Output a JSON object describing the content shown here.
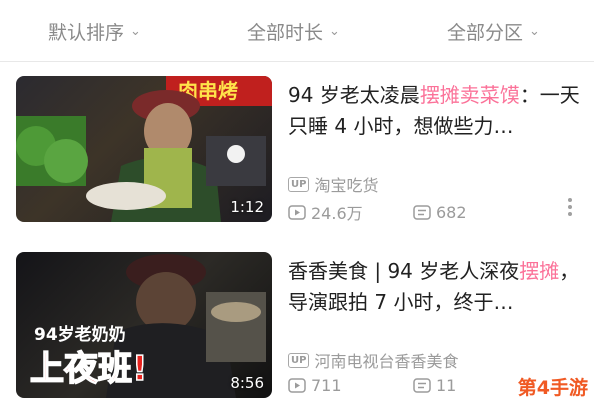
{
  "filters": [
    {
      "label": "默认排序"
    },
    {
      "label": "全部时长"
    },
    {
      "label": "全部分区"
    }
  ],
  "videos": [
    {
      "title_pre": "94 岁老太凌晨",
      "title_hl": "摆摊卖菜馍",
      "title_post": "：一天只睡 4 小时，想做些力…",
      "thumb_sign": "肉串烤",
      "duration": "1:12",
      "uploader": "淘宝吃货",
      "views": "24.6万",
      "danmaku": "682"
    },
    {
      "title_pre": "香香美食 | 94 岁老人深夜",
      "title_hl": "摆摊",
      "title_post": "，导演跟拍 7 小时，终于…",
      "thumb_caption_top": "94岁老奶奶",
      "thumb_caption_bottom": "上夜班!",
      "duration": "8:56",
      "uploader": "河南电视台香香美食",
      "views": "711",
      "danmaku": "11"
    }
  ],
  "up_badge": "UP",
  "watermark": "第4手游",
  "colors": {
    "highlight": "#fb7299",
    "meta": "#9b9b9b",
    "watermark": "#f05a24"
  }
}
